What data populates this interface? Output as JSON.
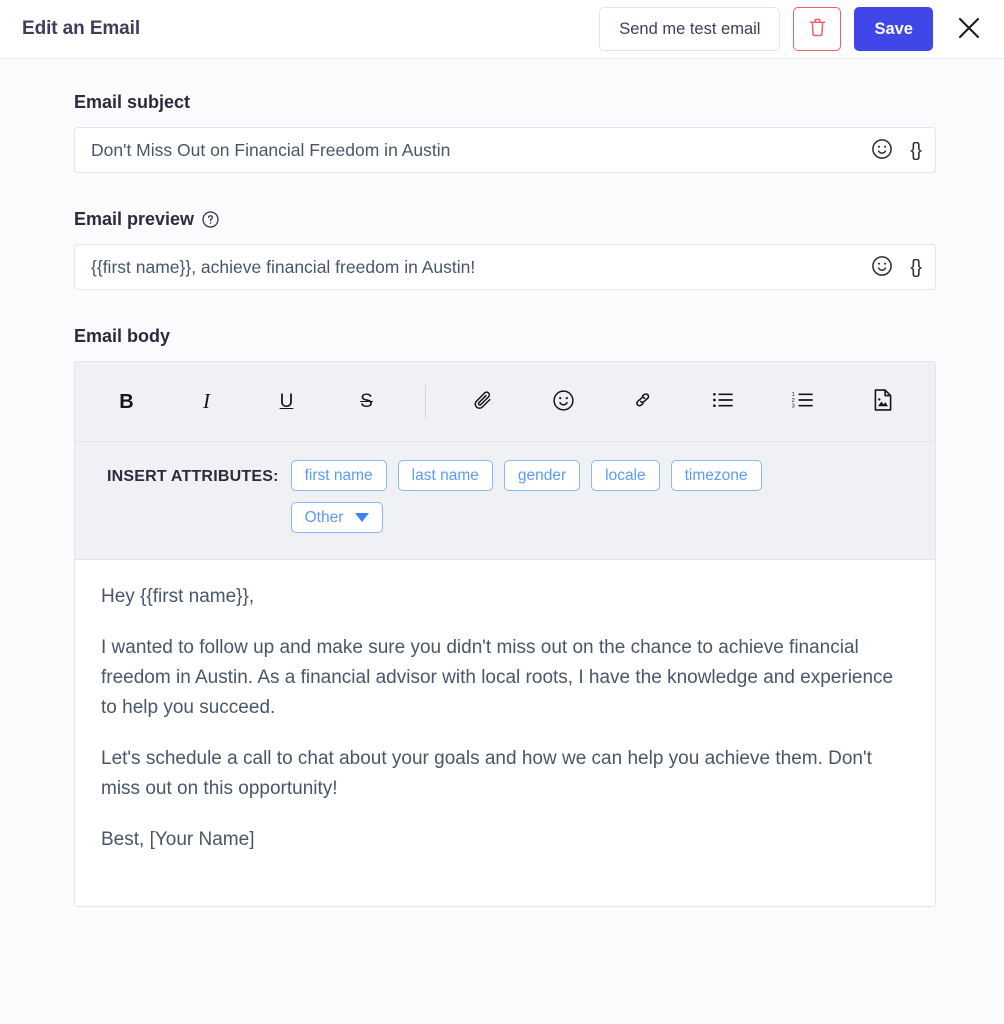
{
  "header": {
    "title": "Edit an Email",
    "test_email_label": "Send me test email",
    "delete_label": "",
    "save_label": "Save",
    "close_label": ""
  },
  "subject": {
    "label": "Email subject",
    "value": "Don't Miss Out on Financial Freedom in Austin",
    "emoji_icon": "smiley-icon",
    "merge_icon": "{}"
  },
  "preview": {
    "label": "Email preview",
    "help_icon": "question-circle-icon",
    "value": "{{first name}}, achieve financial freedom in Austin!",
    "emoji_icon": "smiley-icon",
    "merge_icon": "{}"
  },
  "body": {
    "label": "Email body",
    "toolbar": [
      {
        "name": "bold-button",
        "glyph": "B"
      },
      {
        "name": "italic-button",
        "glyph": "I"
      },
      {
        "name": "underline-button",
        "glyph": "U"
      },
      {
        "name": "strikethrough-button",
        "glyph": "S"
      },
      {
        "name": "attach-button",
        "glyph": "paperclip-icon"
      },
      {
        "name": "emoji-button",
        "glyph": "smiley-icon"
      },
      {
        "name": "link-button",
        "glyph": "link-icon"
      },
      {
        "name": "bullet-list-button",
        "glyph": "bullet-list-icon"
      },
      {
        "name": "numbered-list-button",
        "glyph": "numbered-list-icon"
      },
      {
        "name": "insert-image-button",
        "glyph": "image-file-icon"
      }
    ],
    "attributes_label": "INSERT ATTRIBUTES:",
    "chips": [
      "first name",
      "last name",
      "gender",
      "locale",
      "timezone"
    ],
    "other_chip": "Other",
    "paragraphs": [
      "Hey {{first name}},",
      "I wanted to follow up and make sure you didn't miss out on the chance to achieve financial freedom in Austin. As a financial advisor with local roots, I have the knowledge and experience to help you succeed.",
      "Let's schedule a call to chat about your goals and how we can help you achieve them. Don't miss out on this opportunity!",
      "Best, [Your Name]"
    ]
  },
  "colors": {
    "accent": "#4046E8",
    "danger": "#F2606A",
    "chip_border": "#85B9F7",
    "chip_text": "#5A9CF8",
    "page_bg": "#FAFBFD",
    "toolbar_bg": "#EFF1F5"
  }
}
